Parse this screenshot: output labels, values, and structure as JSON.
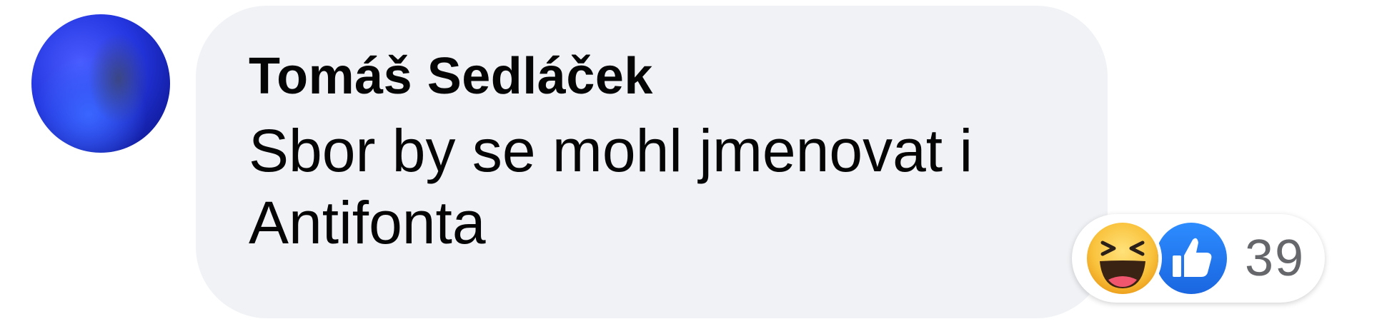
{
  "comment": {
    "author": "Tomáš Sedláček",
    "text": "Sbor by se mohl jmenovat i\nAntifonta",
    "avatar_icon": "profile-photo-icon"
  },
  "reactions": {
    "icons": [
      "haha-reaction-icon",
      "like-reaction-icon"
    ],
    "count": "39",
    "colors": {
      "haha_face": "#f7b125",
      "like_blue": "#1877f2",
      "count_text": "#65676b"
    }
  },
  "colors": {
    "bubble_background": "#f0f2f5",
    "text": "#050505"
  }
}
